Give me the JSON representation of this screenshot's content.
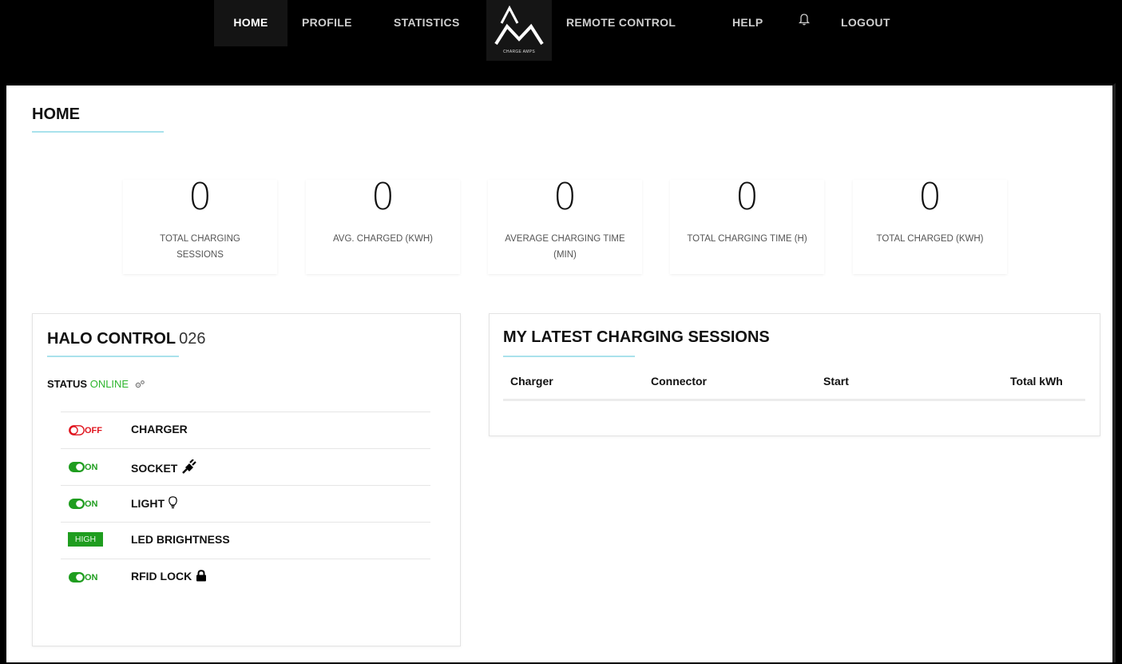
{
  "nav": {
    "home": "HOME",
    "profile": "PROFILE",
    "statistics": "STATISTICS",
    "logo_text": "CHARGE AMPS",
    "remote_control": "REMOTE CONTROL",
    "help": "HELP",
    "logout": "LOGOUT"
  },
  "page_title": "HOME",
  "stats": [
    {
      "value": "0",
      "label": "TOTAL CHARGING SESSIONS"
    },
    {
      "value": "0",
      "label": "AVG. CHARGED (KWH)"
    },
    {
      "value": "0",
      "label": "AVERAGE CHARGING TIME (MIN)"
    },
    {
      "value": "0",
      "label": "TOTAL CHARGING TIME (H)"
    },
    {
      "value": "0",
      "label": "TOTAL CHARGED (KWH)"
    }
  ],
  "halo": {
    "title": "HALO CONTROL",
    "number": "026",
    "status_label": "STATUS",
    "status_value": "ONLINE",
    "controls": [
      {
        "label": "CHARGER",
        "state": "OFF"
      },
      {
        "label": "SOCKET",
        "state": "ON"
      },
      {
        "label": "LIGHT",
        "state": "ON"
      },
      {
        "label": "LED BRIGHTNESS",
        "state": "HIGH"
      },
      {
        "label": "RFID LOCK",
        "state": "ON"
      }
    ]
  },
  "sessions": {
    "title": "MY LATEST CHARGING SESSIONS",
    "columns": [
      "Charger",
      "Connector",
      "Start",
      "Total kWh"
    ]
  },
  "colors": {
    "on": "#1f9d1f",
    "off": "#e0141e",
    "online": "#2db52d",
    "accent_underline": "#a9e2ec"
  },
  "icons": [
    "bell-icon",
    "gear-icon",
    "plug-icon",
    "lightbulb-icon",
    "lock-icon"
  ]
}
